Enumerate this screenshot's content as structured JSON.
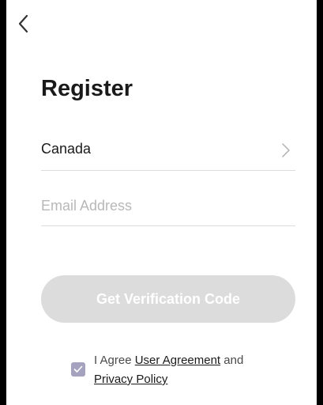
{
  "page": {
    "title": "Register"
  },
  "icons": {
    "back": "back-arrow-icon",
    "chevron": "chevron-right-icon",
    "check": "checkmark-icon"
  },
  "country": {
    "value": "Canada"
  },
  "email": {
    "placeholder": "Email Address",
    "value": ""
  },
  "verify_button": {
    "label": "Get Verification Code"
  },
  "agreement": {
    "checked": true,
    "prefix": "I Agree",
    "user_agreement": "User Agreement",
    "and": "and",
    "privacy_policy": "Privacy Policy"
  },
  "colors": {
    "background": "#ffffff",
    "button_disabled": "#dcdcdc",
    "checkbox": "#a5a2bf",
    "divider": "#dcdcdc",
    "placeholder": "#b8b8b8"
  }
}
